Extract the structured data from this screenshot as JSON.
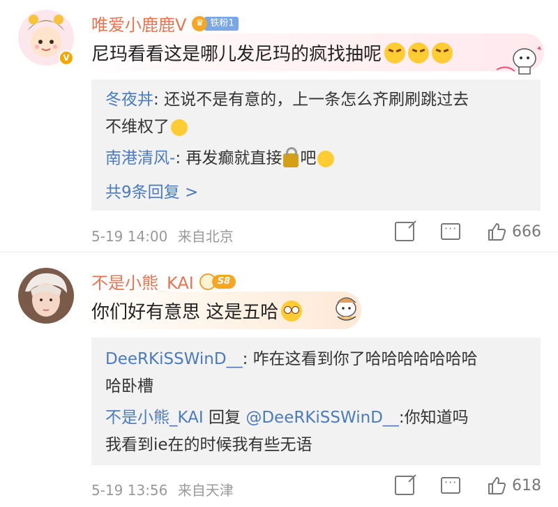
{
  "comments": [
    {
      "username": "唯爱小鹿鹿V",
      "fan_badge": "铁粉1",
      "text": "尼玛看看这是哪儿发尼玛的疯找抽呢",
      "replies": [
        {
          "name": "冬夜丼",
          "sep": ": ",
          "text": "还说不是有意的，上一条怎么齐刷刷跳过去",
          "text2": "不维权了"
        },
        {
          "name": "南港清风-",
          "sep": ": ",
          "text": "再发癫就直接",
          "text_after": "吧"
        }
      ],
      "more_replies": "共9条回复 >",
      "time": "5-19 14:00",
      "location": "来自北京",
      "likes": "666"
    },
    {
      "username": "不是小熊_KAI",
      "level_badge": "S8",
      "text": "你们好有意思 这是五哈",
      "replies": [
        {
          "name": "DeeRKiSSWinD__",
          "sep": ": ",
          "text": "咋在这看到你了哈哈哈哈哈哈哈",
          "text2": "哈卧槽"
        },
        {
          "name": "不是小熊_KAI",
          "mid": " 回复 ",
          "mention": "@DeeRKiSSWinD__",
          "sep": ":",
          "text": "你知道吗",
          "text2": "我看到ie在的时候我有些无语"
        }
      ],
      "time": "5-19 13:56",
      "location": "来自天津",
      "likes": "618"
    }
  ],
  "icons": {
    "verified": "verified-v-badge",
    "share": "share-icon",
    "comment": "comment-icon",
    "like": "like-icon"
  },
  "colors": {
    "username": "#eb7350",
    "reply_name": "#4a7bbd",
    "reply_bg": "#f2f2f2",
    "meta": "#999999"
  }
}
